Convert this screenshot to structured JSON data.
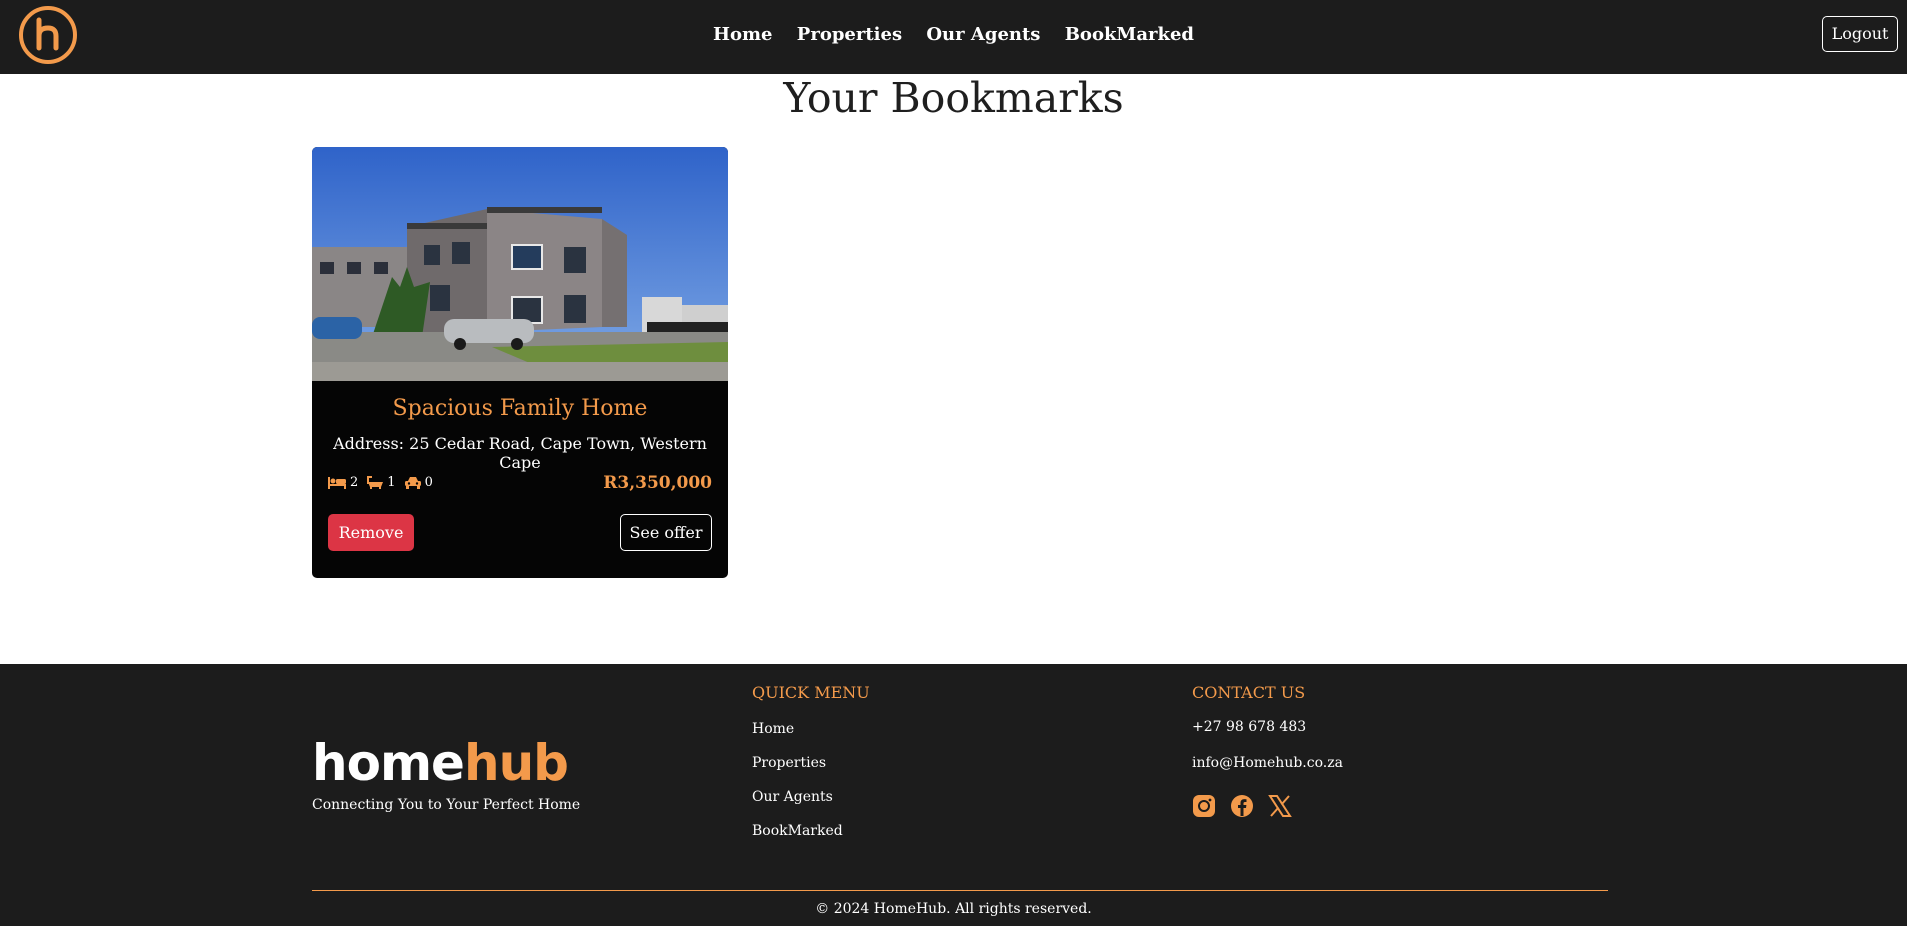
{
  "nav": {
    "links": [
      "Home",
      "Properties",
      "Our Agents",
      "BookMarked"
    ],
    "logout_label": "Logout"
  },
  "page": {
    "title": "Your Bookmarks"
  },
  "bookmarks": [
    {
      "title": "Spacious Family Home",
      "address": "Address: 25 Cedar Road, Cape Town, Western Cape",
      "bedrooms": "2",
      "bathrooms": "1",
      "garages": "0",
      "price": "R3,350,000",
      "remove_label": "Remove",
      "offer_label": "See offer"
    }
  ],
  "footer": {
    "brand_home": "home",
    "brand_hub": "hub",
    "tagline": "Connecting You to Your Perfect Home",
    "quick_menu": {
      "heading": "QUICK MENU",
      "links": [
        "Home",
        "Properties",
        "Our Agents",
        "BookMarked"
      ]
    },
    "contact": {
      "heading": "CONTACT US",
      "phone": "+27 98 678 483",
      "email": "info@Homehub.co.za",
      "social_icons": [
        "instagram-icon",
        "facebook-icon",
        "x-icon"
      ]
    },
    "copyright": "© 2024 HomeHub. All rights reserved."
  },
  "colors": {
    "accent": "#f39a4b",
    "dark": "#1c1c1c",
    "danger": "#dc3545"
  }
}
